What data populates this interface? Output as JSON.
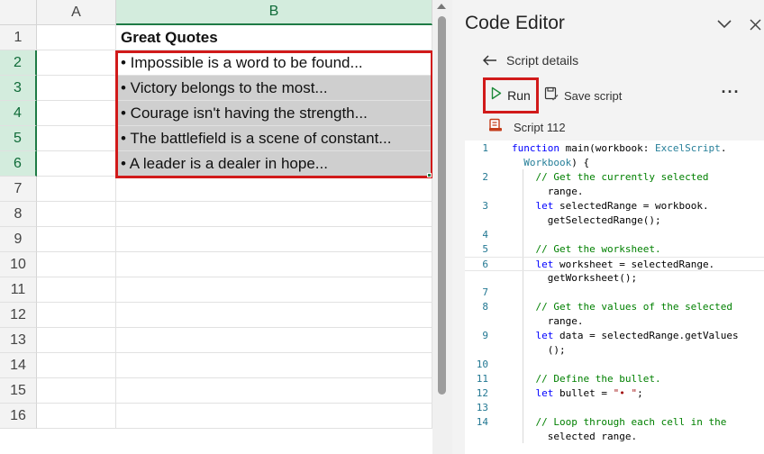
{
  "sheet": {
    "columns": [
      "A",
      "B"
    ],
    "rows": [
      "1",
      "2",
      "3",
      "4",
      "5",
      "6",
      "7",
      "8",
      "9",
      "10",
      "11",
      "12",
      "13",
      "14",
      "15",
      "16"
    ],
    "b1": "Great Quotes",
    "quotes": [
      "• Impossible is a word to be found...",
      "• Victory belongs to the most...",
      "• Courage isn't having the strength...",
      "• The battlefield is a scene of constant...",
      "• A leader is a dealer in hope..."
    ]
  },
  "pane": {
    "title": "Code Editor",
    "back_label": "Script details",
    "run_label": "Run",
    "save_label": "Save script",
    "script_name": "Script 112",
    "icons": {
      "collapse": "chevron-down-icon",
      "close": "close-icon",
      "back": "arrow-left-icon",
      "run": "play-icon",
      "save": "save-icon",
      "more": "more-icon",
      "script": "script-icon"
    },
    "accent": "#d11a1a"
  },
  "code": {
    "line_numbers": [
      "1",
      "",
      "2",
      "",
      "3",
      "",
      "4",
      "5",
      "6",
      "",
      "7",
      "8",
      "",
      "9",
      "",
      "10",
      "11",
      "12",
      "13",
      "14",
      ""
    ],
    "lines": [
      "function main(workbook: ExcelScript.",
      "  Workbook) {",
      "    // Get the currently selected",
      "      range.",
      "    let selectedRange = workbook.",
      "      getSelectedRange();",
      "",
      "    // Get the worksheet.",
      "    let worksheet = selectedRange.",
      "      getWorksheet();",
      "",
      "    // Get the values of the selected",
      "      range.",
      "    let data = selectedRange.getValues",
      "      ();",
      "",
      "    // Define the bullet.",
      "    let bullet = \"• \";",
      "",
      "    // Loop through each cell in the",
      "      selected range."
    ]
  }
}
